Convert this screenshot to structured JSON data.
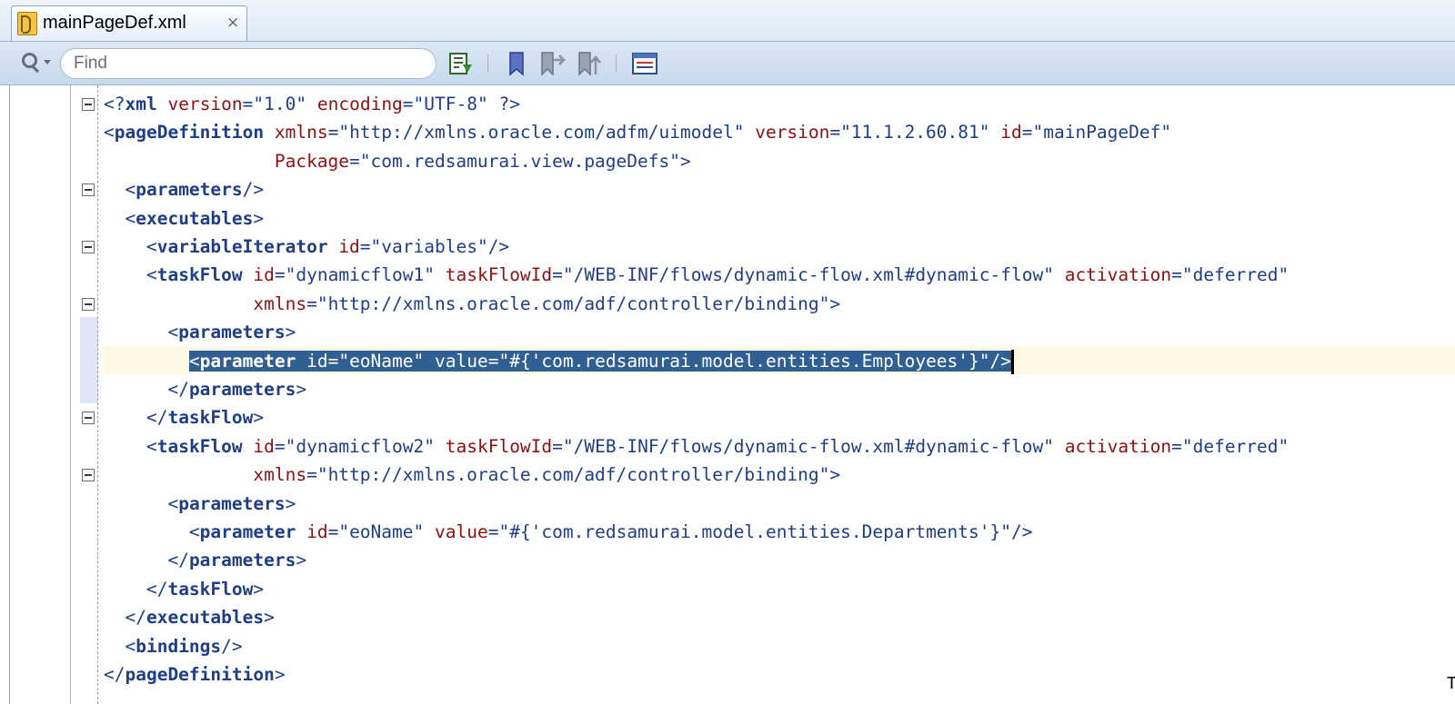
{
  "tab": {
    "title": "mainPageDef.xml",
    "close_glyph": "×",
    "icon": "xml-file-icon"
  },
  "toolbar": {
    "find_placeholder": "Find",
    "buttons": [
      "structure-view-icon",
      "bookmark-icon",
      "previous-bookmark-icon",
      "next-bookmark-icon",
      "code-template-icon"
    ]
  },
  "editor": {
    "selected_line": 10,
    "lines": [
      [
        [
          "tg",
          "<?"
        ],
        [
          "tgb",
          "xml"
        ],
        [
          "txt",
          " "
        ],
        [
          "at",
          "version"
        ],
        [
          "tg",
          "=\""
        ],
        [
          "av",
          "1.0"
        ],
        [
          "tg",
          "\""
        ],
        [
          "txt",
          " "
        ],
        [
          "at",
          "encoding"
        ],
        [
          "tg",
          "=\""
        ],
        [
          "av",
          "UTF-8"
        ],
        [
          "tg",
          "\""
        ],
        [
          "txt",
          " "
        ],
        [
          "tg",
          "?>"
        ]
      ],
      [
        [
          "tg",
          "<"
        ],
        [
          "tgb",
          "pageDefinition"
        ],
        [
          "txt",
          " "
        ],
        [
          "at",
          "xmlns"
        ],
        [
          "tg",
          "=\""
        ],
        [
          "av",
          "http://xmlns.oracle.com/adfm/uimodel"
        ],
        [
          "tg",
          "\""
        ],
        [
          "txt",
          " "
        ],
        [
          "at",
          "version"
        ],
        [
          "tg",
          "=\""
        ],
        [
          "av",
          "11.1.2.60.81"
        ],
        [
          "tg",
          "\""
        ],
        [
          "txt",
          " "
        ],
        [
          "at",
          "id"
        ],
        [
          "tg",
          "=\""
        ],
        [
          "av",
          "mainPageDef"
        ],
        [
          "tg",
          "\""
        ]
      ],
      [
        [
          "txt",
          "                "
        ],
        [
          "at",
          "Package"
        ],
        [
          "tg",
          "=\""
        ],
        [
          "av",
          "com.redsamurai.view.pageDefs"
        ],
        [
          "tg",
          "\">"
        ]
      ],
      [
        [
          "txt",
          "  "
        ],
        [
          "tg",
          "<"
        ],
        [
          "tgb",
          "parameters"
        ],
        [
          "tg",
          "/>"
        ]
      ],
      [
        [
          "txt",
          "  "
        ],
        [
          "tg",
          "<"
        ],
        [
          "tgb",
          "executables"
        ],
        [
          "tg",
          ">"
        ]
      ],
      [
        [
          "txt",
          "    "
        ],
        [
          "tg",
          "<"
        ],
        [
          "tgb",
          "variableIterator"
        ],
        [
          "txt",
          " "
        ],
        [
          "at",
          "id"
        ],
        [
          "tg",
          "=\""
        ],
        [
          "av",
          "variables"
        ],
        [
          "tg",
          "\"/>"
        ]
      ],
      [
        [
          "txt",
          "    "
        ],
        [
          "tg",
          "<"
        ],
        [
          "tgb",
          "taskFlow"
        ],
        [
          "txt",
          " "
        ],
        [
          "at",
          "id"
        ],
        [
          "tg",
          "=\""
        ],
        [
          "av",
          "dynamicflow1"
        ],
        [
          "tg",
          "\""
        ],
        [
          "txt",
          " "
        ],
        [
          "at",
          "taskFlowId"
        ],
        [
          "tg",
          "=\""
        ],
        [
          "av",
          "/WEB-INF/flows/dynamic-flow.xml#dynamic-flow"
        ],
        [
          "tg",
          "\""
        ],
        [
          "txt",
          " "
        ],
        [
          "at",
          "activation"
        ],
        [
          "tg",
          "=\""
        ],
        [
          "av",
          "deferred"
        ],
        [
          "tg",
          "\""
        ]
      ],
      [
        [
          "txt",
          "              "
        ],
        [
          "at",
          "xmlns"
        ],
        [
          "tg",
          "=\""
        ],
        [
          "av",
          "http://xmlns.oracle.com/adf/controller/binding"
        ],
        [
          "tg",
          "\">"
        ]
      ],
      [
        [
          "txt",
          "      "
        ],
        [
          "tg",
          "<"
        ],
        [
          "tgb",
          "parameters"
        ],
        [
          "tg",
          ">"
        ]
      ],
      [
        [
          "txt",
          "        "
        ],
        [
          "sel_start",
          ""
        ],
        [
          "tg",
          "<"
        ],
        [
          "tgb",
          "parameter"
        ],
        [
          "txt",
          " "
        ],
        [
          "at",
          "id"
        ],
        [
          "tg",
          "=\""
        ],
        [
          "av",
          "eoName"
        ],
        [
          "tg",
          "\""
        ],
        [
          "txt",
          " "
        ],
        [
          "at",
          "value"
        ],
        [
          "tg",
          "=\""
        ],
        [
          "av",
          "#{'com.redsamurai.model.entities.Employees'}"
        ],
        [
          "tg",
          "\"/>"
        ]
      ],
      [
        [
          "txt",
          "      "
        ],
        [
          "tg",
          "</"
        ],
        [
          "tgb",
          "parameters"
        ],
        [
          "tg",
          ">"
        ]
      ],
      [
        [
          "txt",
          "    "
        ],
        [
          "tg",
          "</"
        ],
        [
          "tgb",
          "taskFlow"
        ],
        [
          "tg",
          ">"
        ]
      ],
      [
        [
          "txt",
          "    "
        ],
        [
          "tg",
          "<"
        ],
        [
          "tgb",
          "taskFlow"
        ],
        [
          "txt",
          " "
        ],
        [
          "at",
          "id"
        ],
        [
          "tg",
          "=\""
        ],
        [
          "av",
          "dynamicflow2"
        ],
        [
          "tg",
          "\""
        ],
        [
          "txt",
          " "
        ],
        [
          "at",
          "taskFlowId"
        ],
        [
          "tg",
          "=\""
        ],
        [
          "av",
          "/WEB-INF/flows/dynamic-flow.xml#dynamic-flow"
        ],
        [
          "tg",
          "\""
        ],
        [
          "txt",
          " "
        ],
        [
          "at",
          "activation"
        ],
        [
          "tg",
          "=\""
        ],
        [
          "av",
          "deferred"
        ],
        [
          "tg",
          "\""
        ]
      ],
      [
        [
          "txt",
          "              "
        ],
        [
          "at",
          "xmlns"
        ],
        [
          "tg",
          "=\""
        ],
        [
          "av",
          "http://xmlns.oracle.com/adf/controller/binding"
        ],
        [
          "tg",
          "\">"
        ]
      ],
      [
        [
          "txt",
          "      "
        ],
        [
          "tg",
          "<"
        ],
        [
          "tgb",
          "parameters"
        ],
        [
          "tg",
          ">"
        ]
      ],
      [
        [
          "txt",
          "        "
        ],
        [
          "tg",
          "<"
        ],
        [
          "tgb",
          "parameter"
        ],
        [
          "txt",
          " "
        ],
        [
          "at",
          "id"
        ],
        [
          "tg",
          "=\""
        ],
        [
          "av",
          "eoName"
        ],
        [
          "tg",
          "\""
        ],
        [
          "txt",
          " "
        ],
        [
          "at",
          "value"
        ],
        [
          "tg",
          "=\""
        ],
        [
          "av",
          "#{'com.redsamurai.model.entities.Departments'}"
        ],
        [
          "tg",
          "\"/>"
        ]
      ],
      [
        [
          "txt",
          "      "
        ],
        [
          "tg",
          "</"
        ],
        [
          "tgb",
          "parameters"
        ],
        [
          "tg",
          ">"
        ]
      ],
      [
        [
          "txt",
          "    "
        ],
        [
          "tg",
          "</"
        ],
        [
          "tgb",
          "taskFlow"
        ],
        [
          "tg",
          ">"
        ]
      ],
      [
        [
          "txt",
          "  "
        ],
        [
          "tg",
          "</"
        ],
        [
          "tgb",
          "executables"
        ],
        [
          "tg",
          ">"
        ]
      ],
      [
        [
          "txt",
          "  "
        ],
        [
          "tg",
          "<"
        ],
        [
          "tgb",
          "bindings"
        ],
        [
          "tg",
          "/>"
        ]
      ],
      [
        [
          "tg",
          "</"
        ],
        [
          "tgb",
          "pageDefinition"
        ],
        [
          "tg",
          ">"
        ]
      ]
    ],
    "fold_lines": [
      1,
      4,
      6,
      8,
      12,
      14
    ],
    "corner_glyph": "T"
  },
  "colors": {
    "tag": "#1f3e88",
    "attribute": "#8f1010",
    "selection": "#2f5f93",
    "current_line": "#fdf7e4"
  }
}
